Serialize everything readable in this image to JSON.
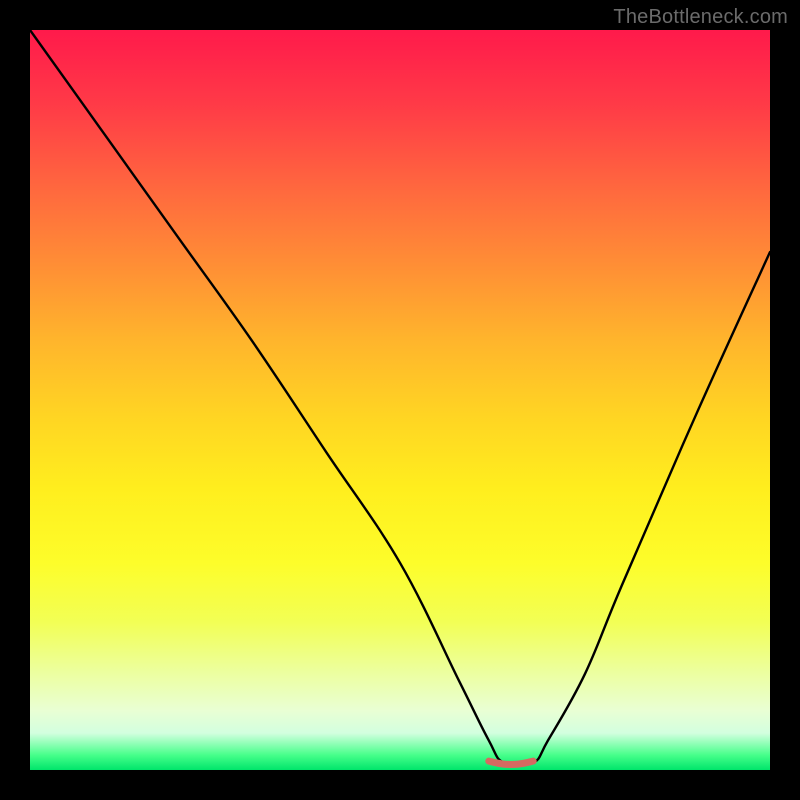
{
  "watermark": "TheBottleneck.com",
  "chart_data": {
    "type": "line",
    "title": "",
    "xlabel": "",
    "ylabel": "",
    "xlim": [
      0,
      100
    ],
    "ylim": [
      0,
      100
    ],
    "series": [
      {
        "name": "bottleneck-curve",
        "x": [
          0,
          10,
          20,
          30,
          40,
          50,
          58,
          62,
          64,
          68,
          70,
          75,
          80,
          90,
          100
        ],
        "values": [
          100,
          86,
          72,
          58,
          43,
          28,
          12,
          4,
          1,
          1,
          4,
          13,
          25,
          48,
          70
        ]
      },
      {
        "name": "optimal-range-marker",
        "x": [
          62,
          64,
          66,
          68
        ],
        "values": [
          1.2,
          0.8,
          0.8,
          1.2
        ]
      }
    ],
    "colors": {
      "curve": "#000000",
      "marker": "#d66a61",
      "gradient_top": "#ff1a4b",
      "gradient_mid": "#ffee1e",
      "gradient_bottom": "#00e56b"
    }
  }
}
